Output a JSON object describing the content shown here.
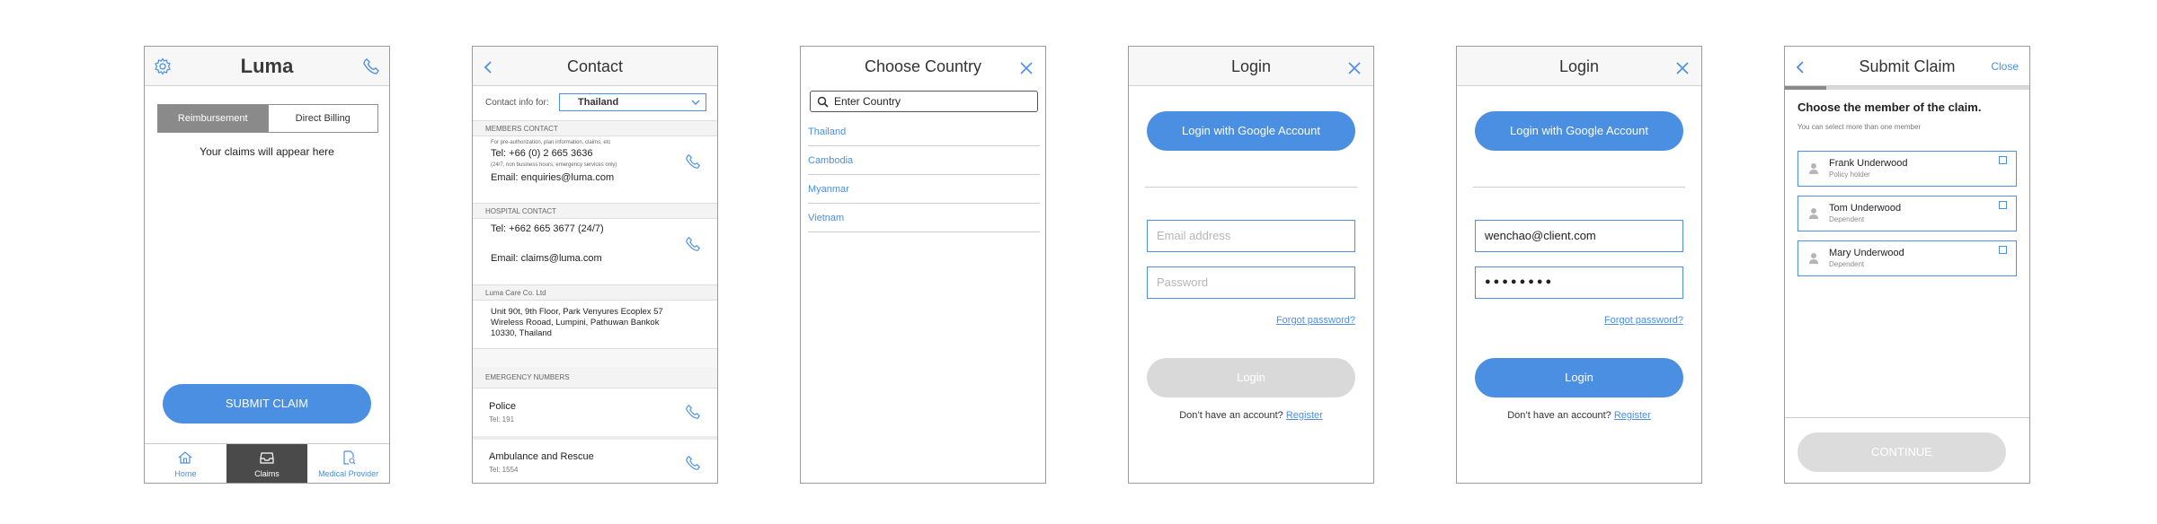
{
  "home": {
    "title": "Luma",
    "seg_reimbursement": "Reimbursement",
    "seg_direct": "Direct Billing",
    "empty_text": "Your claims will appear here",
    "submit_label": "SUBMIT CLAIM",
    "tabs": [
      {
        "label": "Home"
      },
      {
        "label": "Claims"
      },
      {
        "label": "Medical Provider"
      }
    ]
  },
  "contact": {
    "title": "Contact",
    "contact_for_label": "Contact info for:",
    "country_selected": "Thailand",
    "members_header": "MEMBERS CONTACT",
    "members_note": "For pre-authorization, plan information, claims, etc",
    "members_tel": "Tel: +66 (0) 2 665 3636",
    "members_hours": "(24/7, non business hours, emergency services only)",
    "members_email": "Email: enquiries@luma.com",
    "hospital_header": "HOSPITAL CONTACT",
    "hospital_tel": "Tel: +662 665 3677 (24/7)",
    "hospital_email": "Email: claims@luma.com",
    "company_header": "Luma Care Co. Ltd",
    "address_line1": "Unit 90t, 9th Floor, Park Venyures Ecoplex 57",
    "address_line2": "Wireless Rooad, Lumpini, Pathuwan Bankok",
    "address_line3": "10330, Thailand",
    "emergency_header": "EMERGENCY NUMBERS",
    "police_label": "Police",
    "police_tel": "Tel: 191",
    "ambulance_label": "Ambulance and Rescue",
    "ambulance_tel": "Tel: 1554"
  },
  "country": {
    "title": "Choose Country",
    "search_placeholder": "Enter Country",
    "items": [
      "Thailand",
      "Cambodia",
      "Myanmar",
      "Vietnam"
    ]
  },
  "login_empty": {
    "title": "Login",
    "google_label": "Login with Google Account",
    "email_placeholder": "Email address",
    "password_placeholder": "Password",
    "forgot_label": "Forgot password?",
    "login_label": "Login",
    "no_account": "Don’t have an account?",
    "register_label": "Register"
  },
  "login_filled": {
    "title": "Login",
    "google_label": "Login with Google Account",
    "email_value": "wenchao@client.com",
    "password_value": "●●●●●●●●",
    "forgot_label": "Forgot password?",
    "login_label": "Login",
    "no_account": "Don’t have an account?",
    "register_label": "Register"
  },
  "submit_claim": {
    "title": "Submit Claim",
    "close_label": "Close",
    "progress": 0.17,
    "question": "Choose the member of the claim.",
    "hint": "You can select more than one member",
    "members": [
      {
        "name": "Frank Underwood",
        "role": "Policy holder"
      },
      {
        "name": "Tom Underwood",
        "role": "Dependent"
      },
      {
        "name": "Mary Underwood",
        "role": "Dependent"
      }
    ],
    "continue_label": "CONTINUE"
  },
  "colors": {
    "accent": "#4a8fe2",
    "disabled": "#d9d9d9",
    "segment_active": "#8a8a8a"
  }
}
